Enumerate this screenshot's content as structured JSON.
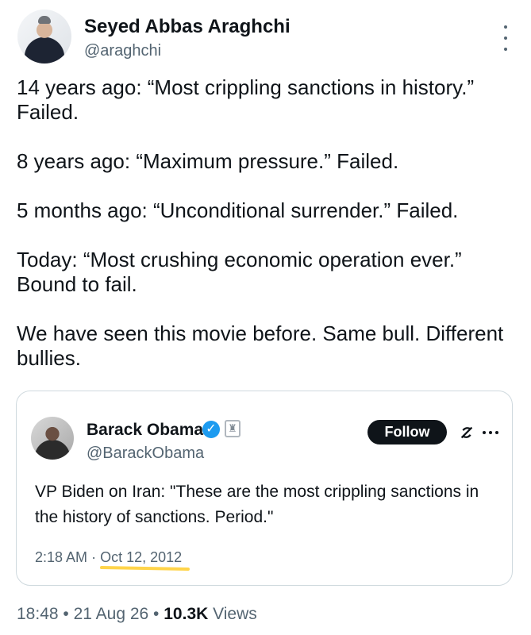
{
  "tweet": {
    "author_name": "Seyed Abbas Araghchi",
    "author_handle": "@araghchi",
    "paragraphs": [
      "14 years ago: “Most crippling sanctions in history.” Failed.",
      "8 years ago: “Maximum pressure.” Failed.",
      "5 months ago: “Unconditional surrender.” Failed.",
      "Today: “Most crushing economic operation ever.” Bound to fail.",
      "We have seen this movie before. Same bull. Different bullies."
    ]
  },
  "quoted_tweet": {
    "author_name": "Barack Obama",
    "author_handle": "@BarackObama",
    "follow_label": "Follow",
    "text": "VP Biden on Iran: \"These are the most crippling sanctions in the history of sanctions. Period.\"",
    "time": "2:18 AM",
    "separator": "·",
    "date": "Oct 12, 2012",
    "highlight_color": "#ffd44a"
  },
  "meta": {
    "time": "18:48",
    "dot1": "•",
    "date": "21 Aug 26",
    "dot2": "•",
    "views_count": "10.3K",
    "views_label": "Views"
  },
  "icons": {
    "more_vertical": "more-vertical-icon",
    "verified": "verified-badge-icon",
    "government": "government-seal-icon",
    "grok": "grok-icon",
    "more_horizontal": "more-horizontal-icon"
  },
  "colors": {
    "text": "#0f1419",
    "secondary": "#536471",
    "verified": "#1d9bf0",
    "border": "#cfd9de"
  }
}
